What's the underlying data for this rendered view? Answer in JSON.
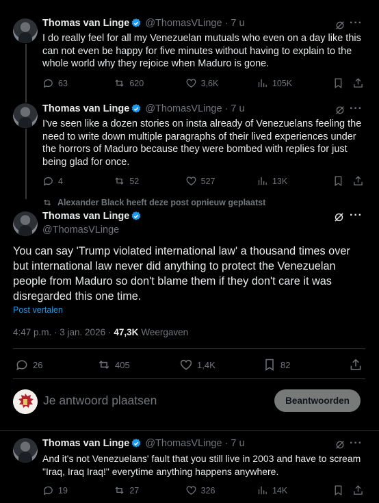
{
  "tweets": [
    {
      "name": "Thomas van Linge",
      "handle": "@ThomasVLinge",
      "time": "· 7 u",
      "text": "I do really feel for all my Venezuelan mutuals who even on a day like this can not even be happy for five minutes without having to explain to the whole world why they rejoice when Maduro is gone.",
      "replies": "63",
      "reposts": "620",
      "likes": "3,6K",
      "views": "105K"
    },
    {
      "name": "Thomas van Linge",
      "handle": "@ThomasVLinge",
      "time": "· 7 u",
      "text": "I've seen like a dozen stories on insta already of Venezuelans feeling the need to write down multiple paragraphs of their lived experiences under the horrors of Maduro because they were bombed with replies for just being glad for once.",
      "replies": "4",
      "reposts": "52",
      "likes": "527",
      "views": "13K"
    }
  ],
  "main_tweet": {
    "repost_notice": "Alexander Black heeft deze post opnieuw geplaatst",
    "name": "Thomas van Linge",
    "handle": "@ThomasVLinge",
    "text": "You can say 'Trump violated international law' a thousand times over but international law never did anything to protect the Venezuelan people from Maduro so don't blame them if they don't care it was disregarded this one time.",
    "translate": "Post vertalen",
    "timestamp": "4:47 p.m. · 3 jan. 2026 ·",
    "views_count": "47,3K",
    "views_label": "Weergaven",
    "replies": "26",
    "reposts": "405",
    "likes": "1,4K",
    "bookmarks": "82"
  },
  "reply_box": {
    "placeholder": "Je antwoord plaatsen",
    "button": "Beantwoorden"
  },
  "last_tweet": {
    "name": "Thomas van Linge",
    "handle": "@ThomasVLinge",
    "time": "· 7 u",
    "text": "And it's not Venezuelans' fault that you still live in 2003 and have to scream \"Iraq, Iraq Iraq!\" everytime anything happens anywhere.",
    "replies": "19",
    "reposts": "27",
    "likes": "326",
    "views": "14K"
  },
  "colors": {
    "accent": "#1d9bf0",
    "muted": "#71767b",
    "text": "#e7e9ea",
    "bg": "#000000"
  }
}
